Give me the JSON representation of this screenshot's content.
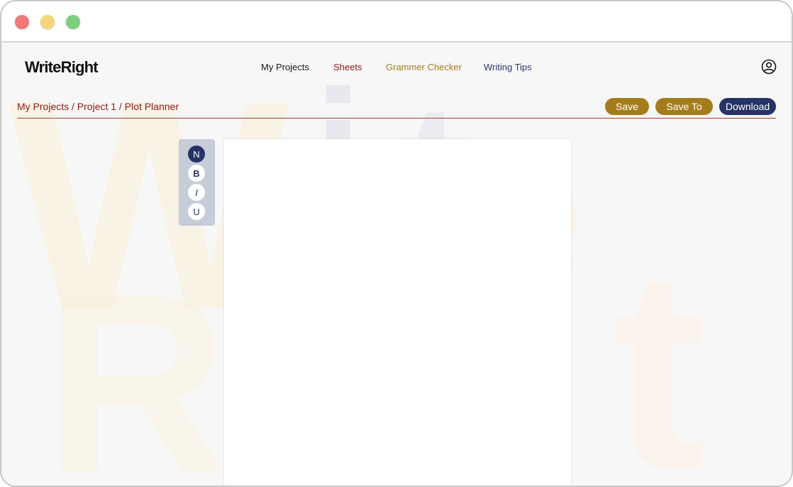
{
  "window_controls": {
    "close_color": "#f37878",
    "minimize_color": "#f7d47a",
    "maximize_color": "#7ccd7c"
  },
  "app": {
    "logo": "WriteRight"
  },
  "nav": {
    "items": [
      {
        "label": "My Projects",
        "color": "#1a1a1a"
      },
      {
        "label": "Sheets",
        "color": "#8b1a1a"
      },
      {
        "label": "Grammer Checker",
        "color": "#a57c1b"
      },
      {
        "label": "Writing Tips",
        "color": "#2a3a66"
      }
    ],
    "profile_icon": "user-circle-icon"
  },
  "breadcrumb": {
    "text": "My Projects / Project 1 / Plot Planner"
  },
  "actions": {
    "save_label": "Save",
    "save_to_label": "Save To",
    "download_label": "Download",
    "save_color": "#a57c1b",
    "download_color": "#263366"
  },
  "format_toolbar": {
    "normal_label": "N",
    "bold_label": "B",
    "italic_label": "I",
    "underline_label": "U",
    "active_color": "#263366"
  },
  "editor": {
    "content": ""
  }
}
